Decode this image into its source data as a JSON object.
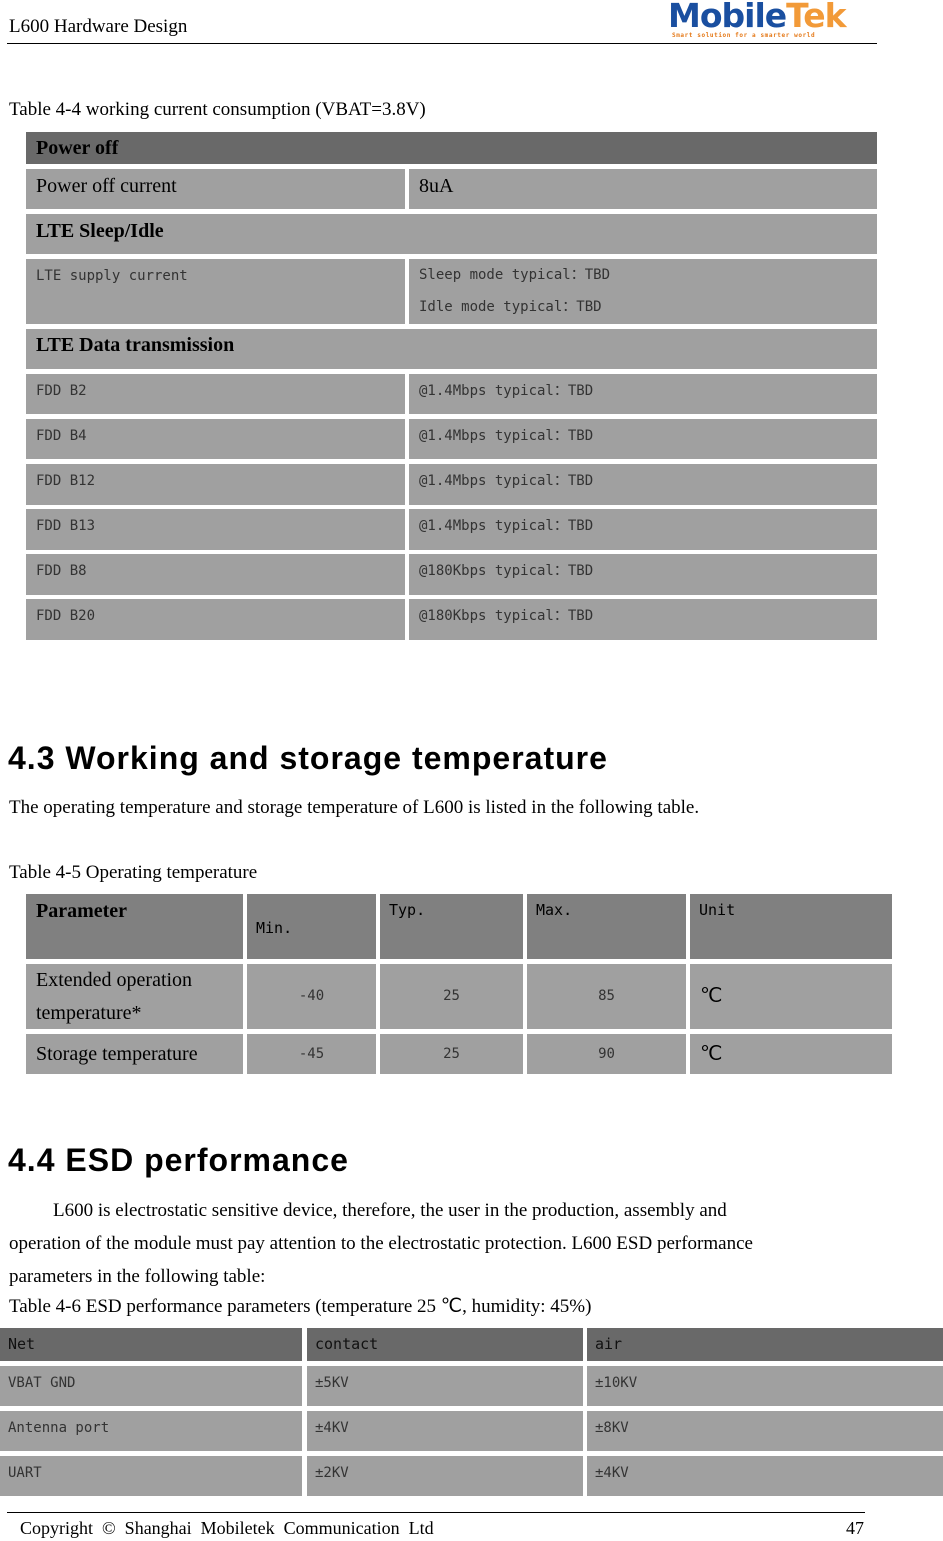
{
  "header": {
    "doc_title": "L600 Hardware Design",
    "logo": {
      "name_left": "Mobile",
      "name_right": "Tek",
      "tagline": "Smart solution for a smarter world",
      "brand_blue": "#1a4fa0",
      "brand_orange": "#f29a38"
    }
  },
  "table44": {
    "caption": "Table 4-4 working current consumption (VBAT=3.8V)",
    "sections": [
      {
        "title": "Power off",
        "rows": [
          {
            "label": "Power off current",
            "value": "8uA"
          }
        ]
      },
      {
        "title": "LTE Sleep/Idle",
        "rows": [
          {
            "label": "LTE supply current",
            "value_lines": [
              "Sleep mode typical：TBD",
              "Idle mode typical：TBD"
            ]
          }
        ]
      },
      {
        "title": "LTE Data transmission",
        "rows": [
          {
            "label": "FDD B2",
            "value": "@1.4Mbps typical：TBD"
          },
          {
            "label": "FDD B4",
            "value": "@1.4Mbps typical：TBD"
          },
          {
            "label": "FDD B12",
            "value": "@1.4Mbps typical：TBD"
          },
          {
            "label": "FDD B13",
            "value": "@1.4Mbps typical：TBD"
          },
          {
            "label": "FDD B8",
            "value": "@180Kbps typical：TBD"
          },
          {
            "label": "FDD B20",
            "value": "@180Kbps typical：TBD"
          }
        ]
      }
    ]
  },
  "section43": {
    "heading": "4.3 Working and storage temperature",
    "intro": "The operating temperature and storage temperature of L600 is listed in the following table."
  },
  "table45": {
    "caption": "Table 4-5 Operating temperature",
    "headers": [
      "Parameter",
      "Min.",
      "Typ.",
      "Max.",
      "Unit"
    ],
    "rows": [
      {
        "parameter_lines": [
          "Extended operation",
          "temperature*"
        ],
        "min": "-40",
        "typ": "25",
        "max": "85",
        "unit": "℃"
      },
      {
        "parameter": "Storage temperature",
        "min": "-45",
        "typ": "25",
        "max": "90",
        "unit": "℃"
      }
    ]
  },
  "section44": {
    "heading": "4.4 ESD performance",
    "para_lines": [
      "L600 is electrostatic sensitive device, therefore, the user in the production, assembly and",
      "operation of the module must pay attention to the electrostatic protection. L600 ESD performance",
      "parameters in the following table:"
    ]
  },
  "table46": {
    "caption": "Table 4-6 ESD performance parameters (temperature 25  ℃, humidity: 45%)",
    "headers": [
      "Net",
      "contact",
      "air"
    ],
    "rows": [
      {
        "net": "VBAT GND",
        "contact": "±5KV",
        "air": "±10KV"
      },
      {
        "net": "Antenna port",
        "contact": "±4KV",
        "air": "±8KV"
      },
      {
        "net": "UART",
        "contact": "±2KV",
        "air": "±4KV"
      }
    ]
  },
  "footer": {
    "copyright": "Copyright  ©  Shanghai  Mobiletek  Communication  Ltd",
    "page_number": "47"
  }
}
